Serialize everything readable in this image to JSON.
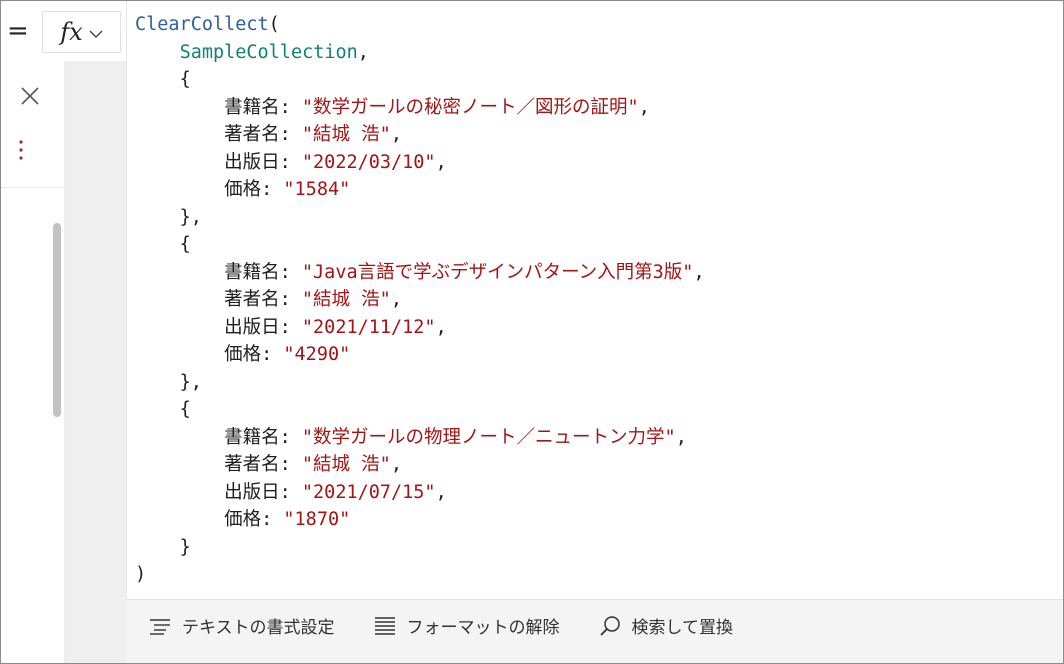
{
  "formula_bar": {
    "equals_sign": "=",
    "fx_label": "fx",
    "fx_icon": "chevron-down-icon"
  },
  "side_panel": {
    "close_icon": "close-icon",
    "more_icon": "more-vertical-icon"
  },
  "code": {
    "function": "ClearCollect",
    "collection": "SampleCollection",
    "records": [
      {
        "title_key": "書籍名",
        "title_value": "\"数学ガールの秘密ノート／図形の証明\"",
        "author_key": "著者名",
        "author_value": "\"結城 浩\"",
        "date_key": "出版日",
        "date_value": "\"2022/03/10\"",
        "price_key": "価格",
        "price_value": "\"1584\""
      },
      {
        "title_key": "書籍名",
        "title_value": "\"Java言語で学ぶデザインパターン入門第3版\"",
        "author_key": "著者名",
        "author_value": "\"結城 浩\"",
        "date_key": "出版日",
        "date_value": "\"2021/11/12\"",
        "price_key": "価格",
        "price_value": "\"4290\""
      },
      {
        "title_key": "書籍名",
        "title_value": "\"数学ガールの物理ノート／ニュートン力学\"",
        "author_key": "著者名",
        "author_value": "\"結城 浩\"",
        "date_key": "出版日",
        "date_value": "\"2021/07/15\"",
        "price_key": "価格",
        "price_value": "\"1870\""
      }
    ]
  },
  "toolbar": {
    "format_text_label": "テキストの書式設定",
    "remove_format_label": "フォーマットの解除",
    "find_replace_label": "検索して置換"
  },
  "colors": {
    "function": "#2f5fa3",
    "identifier": "#138076",
    "string": "#a31515",
    "text": "#1e1e1e",
    "toolbar_bg": "#f4f4f4",
    "gutter_bg": "#efefef"
  }
}
